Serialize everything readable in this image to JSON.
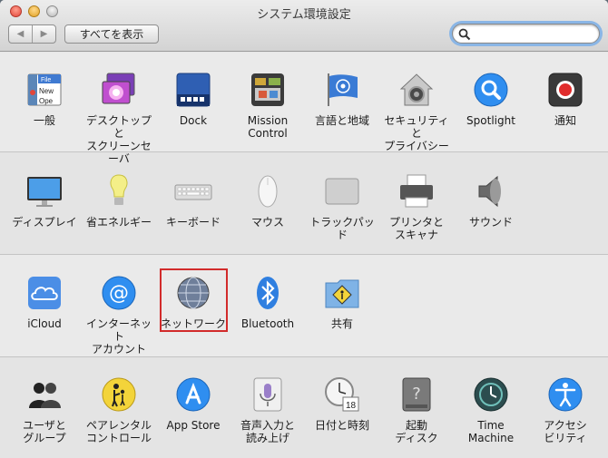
{
  "window": {
    "title": "システム環境設定",
    "show_all_label": "すべてを表示",
    "nav_back": "◀",
    "nav_forward": "▶",
    "search_placeholder": ""
  },
  "rows": [
    [
      {
        "name": "general",
        "label": "一般",
        "icon": "general-icon"
      },
      {
        "name": "desktop",
        "label": "デスクトップと\nスクリーンセーバ",
        "icon": "desktop-icon"
      },
      {
        "name": "dock",
        "label": "Dock",
        "icon": "dock-icon"
      },
      {
        "name": "mission-control",
        "label": "Mission\nControl",
        "icon": "mission-control-icon"
      },
      {
        "name": "language",
        "label": "言語と地域",
        "icon": "flag-icon"
      },
      {
        "name": "security",
        "label": "セキュリティと\nプライバシー",
        "icon": "house-lock-icon"
      },
      {
        "name": "spotlight",
        "label": "Spotlight",
        "icon": "magnifier-icon"
      },
      {
        "name": "notifications",
        "label": "通知",
        "icon": "notification-icon"
      }
    ],
    [
      {
        "name": "displays",
        "label": "ディスプレイ",
        "icon": "display-icon"
      },
      {
        "name": "energy",
        "label": "省エネルギー",
        "icon": "lightbulb-icon"
      },
      {
        "name": "keyboard",
        "label": "キーボード",
        "icon": "keyboard-icon"
      },
      {
        "name": "mouse",
        "label": "マウス",
        "icon": "mouse-icon"
      },
      {
        "name": "trackpad",
        "label": "トラックパッド",
        "icon": "trackpad-icon"
      },
      {
        "name": "printers",
        "label": "プリンタと\nスキャナ",
        "icon": "printer-icon"
      },
      {
        "name": "sound",
        "label": "サウンド",
        "icon": "speaker-icon"
      }
    ],
    [
      {
        "name": "icloud",
        "label": "iCloud",
        "icon": "cloud-icon"
      },
      {
        "name": "internet-accounts",
        "label": "インターネット\nアカウント",
        "icon": "at-icon"
      },
      {
        "name": "network",
        "label": "ネットワーク",
        "icon": "globe-icon"
      },
      {
        "name": "bluetooth",
        "label": "Bluetooth",
        "icon": "bluetooth-icon"
      },
      {
        "name": "sharing",
        "label": "共有",
        "icon": "shared-folder-icon"
      }
    ],
    [
      {
        "name": "users",
        "label": "ユーザと\nグループ",
        "icon": "users-icon"
      },
      {
        "name": "parental",
        "label": "ペアレンタル\nコントロール",
        "icon": "parental-icon"
      },
      {
        "name": "app-store",
        "label": "App Store",
        "icon": "app-store-icon"
      },
      {
        "name": "dictation",
        "label": "音声入力と\n読み上げ",
        "icon": "microphone-icon"
      },
      {
        "name": "date-time",
        "label": "日付と時刻",
        "icon": "clock-calendar-icon"
      },
      {
        "name": "startup-disk",
        "label": "起動\nディスク",
        "icon": "hard-drive-icon"
      },
      {
        "name": "time-machine",
        "label": "Time\nMachine",
        "icon": "time-machine-icon"
      },
      {
        "name": "accessibility",
        "label": "アクセシ\nビリティ",
        "icon": "accessibility-icon"
      }
    ]
  ],
  "icon_badges": {
    "general_file": "File",
    "general_new": "New",
    "general_open": "Ope",
    "calendar_day": "18"
  }
}
